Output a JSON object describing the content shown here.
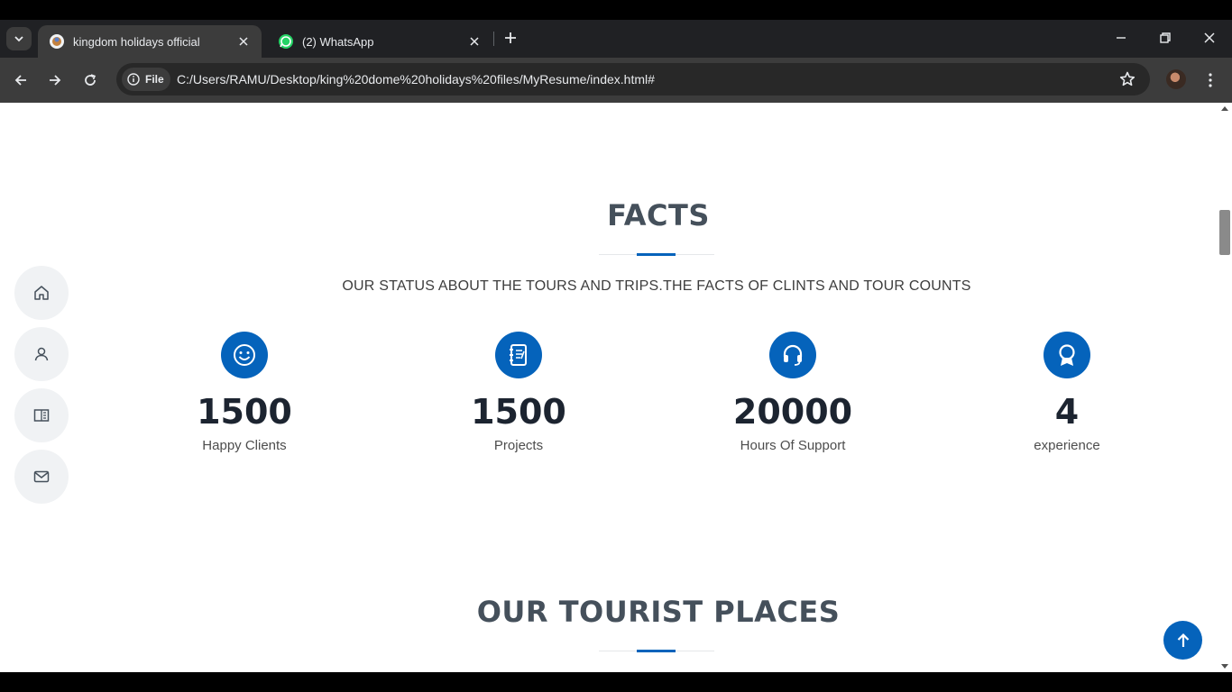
{
  "browser": {
    "tabs": [
      {
        "title": "kingdom holidays official",
        "active": true,
        "favicon": "chrome-globe-icon"
      },
      {
        "title": "(2) WhatsApp",
        "active": false,
        "favicon": "whatsapp-icon"
      }
    ],
    "site_chip": "File",
    "url": "C:/Users/RAMU/Desktop/king%20dome%20holidays%20files/MyResume/index.html#"
  },
  "sidenav": [
    {
      "name": "home",
      "icon": "home-icon"
    },
    {
      "name": "about",
      "icon": "person-icon"
    },
    {
      "name": "resume",
      "icon": "book-icon"
    },
    {
      "name": "contact",
      "icon": "mail-icon"
    }
  ],
  "facts": {
    "title": "FACTS",
    "subtitle": "OUR STATUS ABOUT THE TOURS AND TRIPS.THE FACTS OF CLINTS AND TOUR COUNTS",
    "items": [
      {
        "value": "1500",
        "label": "Happy Clients",
        "icon": "smiley-icon"
      },
      {
        "value": "1500",
        "label": "Projects",
        "icon": "journal-icon"
      },
      {
        "value": "20000",
        "label": "Hours Of Support",
        "icon": "headset-icon"
      },
      {
        "value": "4",
        "label": "experience",
        "icon": "award-icon"
      }
    ]
  },
  "places": {
    "title": "OUR TOURIST PLACES"
  },
  "colors": {
    "accent": "#0563bb",
    "heading": "#45505b",
    "tabstrip": "#202124",
    "toolbar": "#3c3c3c"
  }
}
